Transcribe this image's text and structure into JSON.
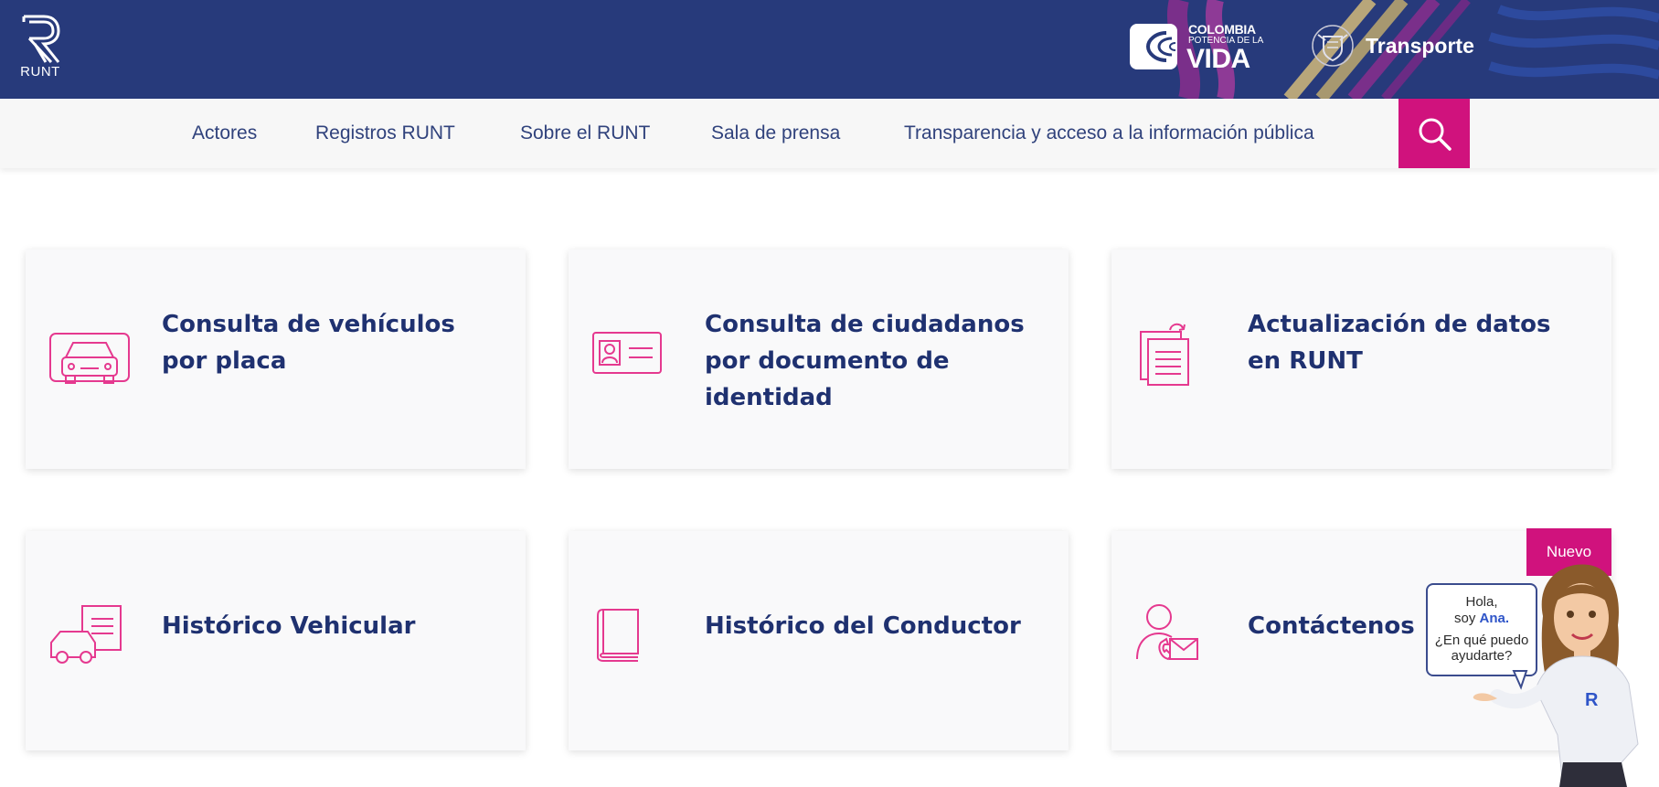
{
  "header": {
    "logo_text": "RUNT",
    "colombia_line1": "COLOMBIA",
    "colombia_line2": "POTENCIA DE LA",
    "colombia_line3": "VIDA",
    "ministry_label": "Transporte"
  },
  "nav": {
    "items": [
      {
        "label": "Actores"
      },
      {
        "label": "Registros RUNT"
      },
      {
        "label": "Sobre el RUNT"
      },
      {
        "label": "Sala de prensa"
      },
      {
        "label": "Transparencia y acceso a la información pública"
      }
    ],
    "search_icon": "search-icon"
  },
  "cards": [
    {
      "title": "Consulta de vehículos por placa",
      "icon": "car-icon"
    },
    {
      "title": "Consulta de ciudadanos por documento de identidad",
      "icon": "id-card-icon"
    },
    {
      "title": "Actualización de datos en RUNT",
      "icon": "document-refresh-icon"
    },
    {
      "title": "Histórico Vehicular",
      "icon": "vehicle-history-icon"
    },
    {
      "title": "Histórico del Conductor",
      "icon": "book-icon"
    },
    {
      "title": "Contáctenos",
      "icon": "contact-icon"
    }
  ],
  "badge": {
    "label": "Nuevo"
  },
  "assistant": {
    "greeting": "Hola,",
    "intro": "soy ",
    "name": "Ana.",
    "question": "¿En qué puedo ayudarte?"
  },
  "colors": {
    "header_bg": "#273a7b",
    "accent": "#d0127d",
    "icon_pink": "#e5398f",
    "title": "#1f3170"
  }
}
